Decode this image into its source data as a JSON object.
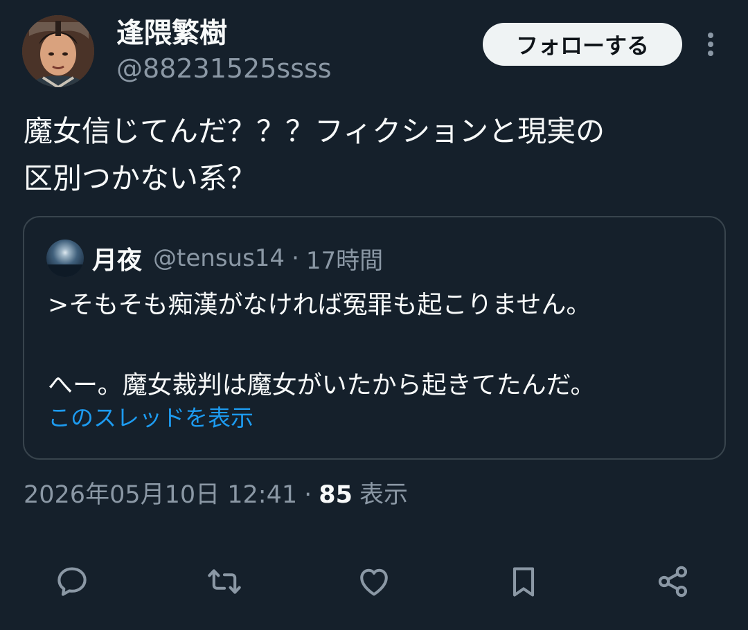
{
  "author": {
    "display_name": "逢隈繁樹",
    "handle": "@88231525ssss",
    "follow_label": "フォローする"
  },
  "tweet": {
    "text": "魔女信じてんだ？？？フィクションと現実の\n区別つかない系？",
    "timestamp": "2026年05月10日 12:41",
    "separator": "·",
    "views_count": "85",
    "views_label": "表示"
  },
  "quote": {
    "name": "月夜",
    "handle": "@tensus14",
    "separator": "·",
    "time": "17時間",
    "text": ">そもそも痴漢がなければ冤罪も起こりません。\n\nへー。魔女裁判は魔女がいたから起きてたんだ。",
    "show_thread": "このスレッドを表示"
  },
  "icons": {
    "more": "more-vertical-icon",
    "reply": "reply-icon",
    "retweet": "retweet-icon",
    "like": "like-icon",
    "bookmark": "bookmark-icon",
    "share": "share-icon"
  },
  "colors": {
    "background": "#15202b",
    "text_primary": "#f7f9f9",
    "text_secondary": "#8b98a5",
    "link": "#1d9bf0",
    "border": "#38444d",
    "button_bg": "#eff3f4",
    "button_text": "#0f1419"
  }
}
